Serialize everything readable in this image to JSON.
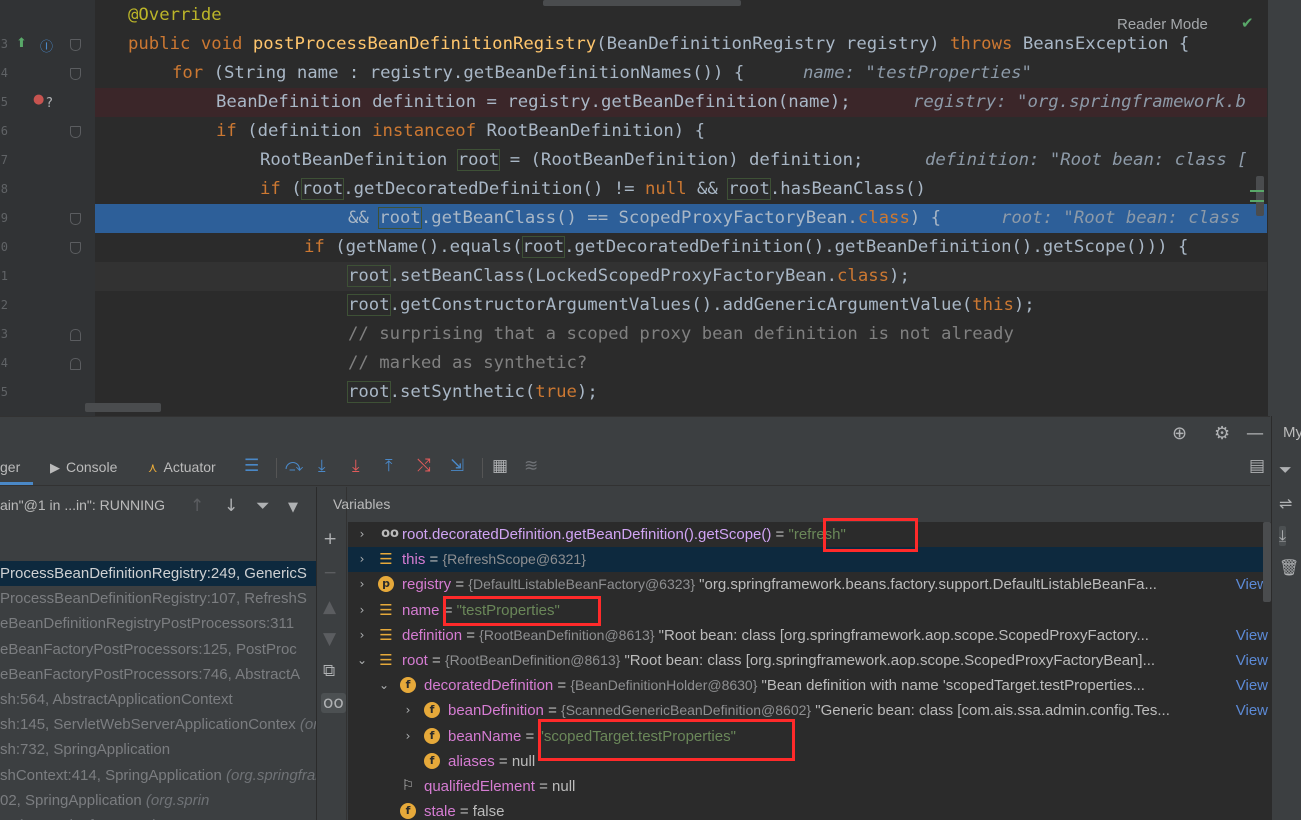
{
  "editor": {
    "reader_mode": "Reader Mode",
    "gutter_numbers": [
      "3",
      "4",
      "5",
      "6",
      "7",
      "8",
      "9",
      "0",
      "1",
      "2",
      "3",
      "4",
      "5"
    ],
    "lines": [
      {
        "segments": [
          {
            "t": "@Override",
            "c": "ann"
          }
        ],
        "indent": 128
      },
      {
        "segments": [
          {
            "t": "public ",
            "c": "kw"
          },
          {
            "t": "void ",
            "c": "kw"
          },
          {
            "t": "postProcessBeanDefinitionRegistry",
            "c": "fn"
          },
          {
            "t": "(BeanDefinitionRegistry registry) ",
            "c": ""
          },
          {
            "t": "throws ",
            "c": "kw"
          },
          {
            "t": "BeansException {",
            "c": ""
          }
        ],
        "indent": 128
      },
      {
        "segments": [
          {
            "t": "for ",
            "c": "kw"
          },
          {
            "t": "(String name : registry.getBeanDefinitionNames()) {",
            "c": ""
          }
        ],
        "indent": 172,
        "hint": "name: \"testProperties\""
      },
      {
        "segments": [
          {
            "t": "BeanDefinition definition = registry.getBeanDefinition(name);",
            "c": ""
          }
        ],
        "indent": 216,
        "hint": "registry: \"org.springframework.b"
      },
      {
        "segments": [
          {
            "t": "if ",
            "c": "kw"
          },
          {
            "t": "(definition ",
            "c": ""
          },
          {
            "t": "instanceof ",
            "c": "kw"
          },
          {
            "t": "RootBeanDefinition) {",
            "c": ""
          }
        ],
        "indent": 216
      },
      {
        "segments": [
          {
            "t": "RootBeanDefinition ",
            "c": ""
          },
          {
            "t": "root",
            "c": "ref"
          },
          {
            "t": " = (RootBeanDefinition) definition;",
            "c": ""
          }
        ],
        "indent": 260,
        "hint": "definition: \"Root bean: class ["
      },
      {
        "segments": [
          {
            "t": "if ",
            "c": "kw"
          },
          {
            "t": "(",
            "c": ""
          },
          {
            "t": "root",
            "c": "ref"
          },
          {
            "t": ".getDecoratedDefinition() != ",
            "c": ""
          },
          {
            "t": "null ",
            "c": "kw"
          },
          {
            "t": "&& ",
            "c": ""
          },
          {
            "t": "root",
            "c": "ref"
          },
          {
            "t": ".hasBeanClass()",
            "c": ""
          }
        ],
        "indent": 260
      },
      {
        "segments": [
          {
            "t": "&& ",
            "c": ""
          },
          {
            "t": "root",
            "c": "ref"
          },
          {
            "t": ".getBeanClass() == ScopedProxyFactoryBean.",
            "c": ""
          },
          {
            "t": "class",
            "c": "kw"
          },
          {
            "t": ") {",
            "c": ""
          }
        ],
        "indent": 348,
        "hint": "root: \"Root bean: class"
      },
      {
        "segments": [
          {
            "t": "if ",
            "c": "kw"
          },
          {
            "t": "(getName().equals(",
            "c": ""
          },
          {
            "t": "root",
            "c": "ref"
          },
          {
            "t": ".getDecoratedDefinition().getBeanDefinition().getScope())) {",
            "c": ""
          }
        ],
        "indent": 304
      },
      {
        "segments": [
          {
            "t": "root",
            "c": "ref"
          },
          {
            "t": ".setBeanClass(LockedScopedProxyFactoryBean.",
            "c": ""
          },
          {
            "t": "class",
            "c": "kw"
          },
          {
            "t": ");",
            "c": ""
          }
        ],
        "indent": 348
      },
      {
        "segments": [
          {
            "t": "root",
            "c": "ref"
          },
          {
            "t": ".getConstructorArgumentValues().addGenericArgumentValue(",
            "c": ""
          },
          {
            "t": "this",
            "c": "kw"
          },
          {
            "t": ");",
            "c": ""
          }
        ],
        "indent": 348
      },
      {
        "segments": [
          {
            "t": "// surprising that a scoped proxy bean definition is not already",
            "c": "cm"
          }
        ],
        "indent": 348
      },
      {
        "segments": [
          {
            "t": "// marked as synthetic?",
            "c": "cm"
          }
        ],
        "indent": 348
      },
      {
        "segments": [
          {
            "t": "root",
            "c": "ref"
          },
          {
            "t": ".setSynthetic(",
            "c": ""
          },
          {
            "t": "true",
            "c": "kw"
          },
          {
            "t": ");",
            "c": ""
          }
        ],
        "indent": 348
      }
    ]
  },
  "tool": {
    "tabs": {
      "debugger": "ger",
      "console": "Console",
      "actuator": "Actuator"
    },
    "right_label": "My",
    "thread": "ain\"@1 in ...in\": RUNNING",
    "frames": [
      "ProcessBeanDefinitionRegistry:249, GenericS",
      "ProcessBeanDefinitionRegistry:107, RefreshS",
      "eBeanDefinitionRegistryPostProcessors:311",
      "eBeanFactoryPostProcessors:125, PostProc",
      "eBeanFactoryPostProcessors:746, AbstractA",
      "sh:564, AbstractApplicationContext",
      "sh:145, ServletWebServerApplicationContex",
      "sh:732, SpringApplication",
      "shContext:414, SpringApplication",
      "02, SpringApplication",
      "..."
    ],
    "frame_pkgs": [
      "",
      "",
      "",
      "",
      "",
      "",
      " (org.sprin",
      "",
      " (org.springframew",
      " (org.sprin",
      " (org.springframework",
      ""
    ],
    "variables_label": "Variables",
    "variables": [
      {
        "arrow": "›",
        "icon": "oo",
        "name": "root.decoratedDefinition.getBeanDefinition().getScope()",
        "eq": " = ",
        "type": "",
        "value": "\"refresh\"",
        "vclass": "str",
        "view": ""
      },
      {
        "arrow": "›",
        "icon": "lines",
        "name": "this",
        "eq": " = ",
        "type": "{RefreshScope@6321}",
        "value": "",
        "vclass": "plain",
        "view": ""
      },
      {
        "arrow": "›",
        "icon": "p",
        "name": "registry",
        "eq": " = ",
        "type": "{DefaultListableBeanFactory@6323}",
        "value": " \"org.springframework.beans.factory.support.DefaultListableBeanFa...",
        "vclass": "plain",
        "view": "View"
      },
      {
        "arrow": "›",
        "icon": "lines",
        "name": "name",
        "eq": " = ",
        "type": "",
        "value": "\"testProperties\"",
        "vclass": "str",
        "view": ""
      },
      {
        "arrow": "›",
        "icon": "lines",
        "name": "definition",
        "eq": " = ",
        "type": "{RootBeanDefinition@8613}",
        "value": " \"Root bean: class [org.springframework.aop.scope.ScopedProxyFactory...",
        "vclass": "plain",
        "view": "View"
      },
      {
        "arrow": "⌄",
        "icon": "lines",
        "name": "root",
        "eq": " = ",
        "type": "{RootBeanDefinition@8613}",
        "value": " \"Root bean: class [org.springframework.aop.scope.ScopedProxyFactoryBean]...",
        "vclass": "plain",
        "view": "View"
      },
      {
        "arrow": "⌄",
        "icon": "f",
        "name": "decoratedDefinition",
        "eq": " = ",
        "type": "{BeanDefinitionHolder@8630}",
        "value": " \"Bean definition with name 'scopedTarget.testProperties...",
        "vclass": "plain",
        "view": "View"
      },
      {
        "arrow": "›",
        "icon": "f",
        "name": "beanDefinition",
        "eq": " = ",
        "type": "{ScannedGenericBeanDefinition@8602}",
        "value": " \"Generic bean: class [com.ais.ssa.admin.config.Tes...",
        "vclass": "plain",
        "view": "View"
      },
      {
        "arrow": "›",
        "icon": "f",
        "name": "beanName",
        "eq": " = ",
        "type": "",
        "value": "\"scopedTarget.testProperties\"",
        "vclass": "str",
        "view": ""
      },
      {
        "arrow": "",
        "icon": "f",
        "name": "aliases",
        "eq": " = ",
        "type": "",
        "value": "null",
        "vclass": "plain",
        "view": ""
      },
      {
        "arrow": "",
        "icon": "flag",
        "name": "qualifiedElement",
        "eq": " = ",
        "type": "",
        "value": "null",
        "vclass": "plain",
        "view": ""
      },
      {
        "arrow": "",
        "icon": "f",
        "name": "stale",
        "eq": " = ",
        "type": "",
        "value": "false",
        "vclass": "plain",
        "view": ""
      }
    ]
  }
}
